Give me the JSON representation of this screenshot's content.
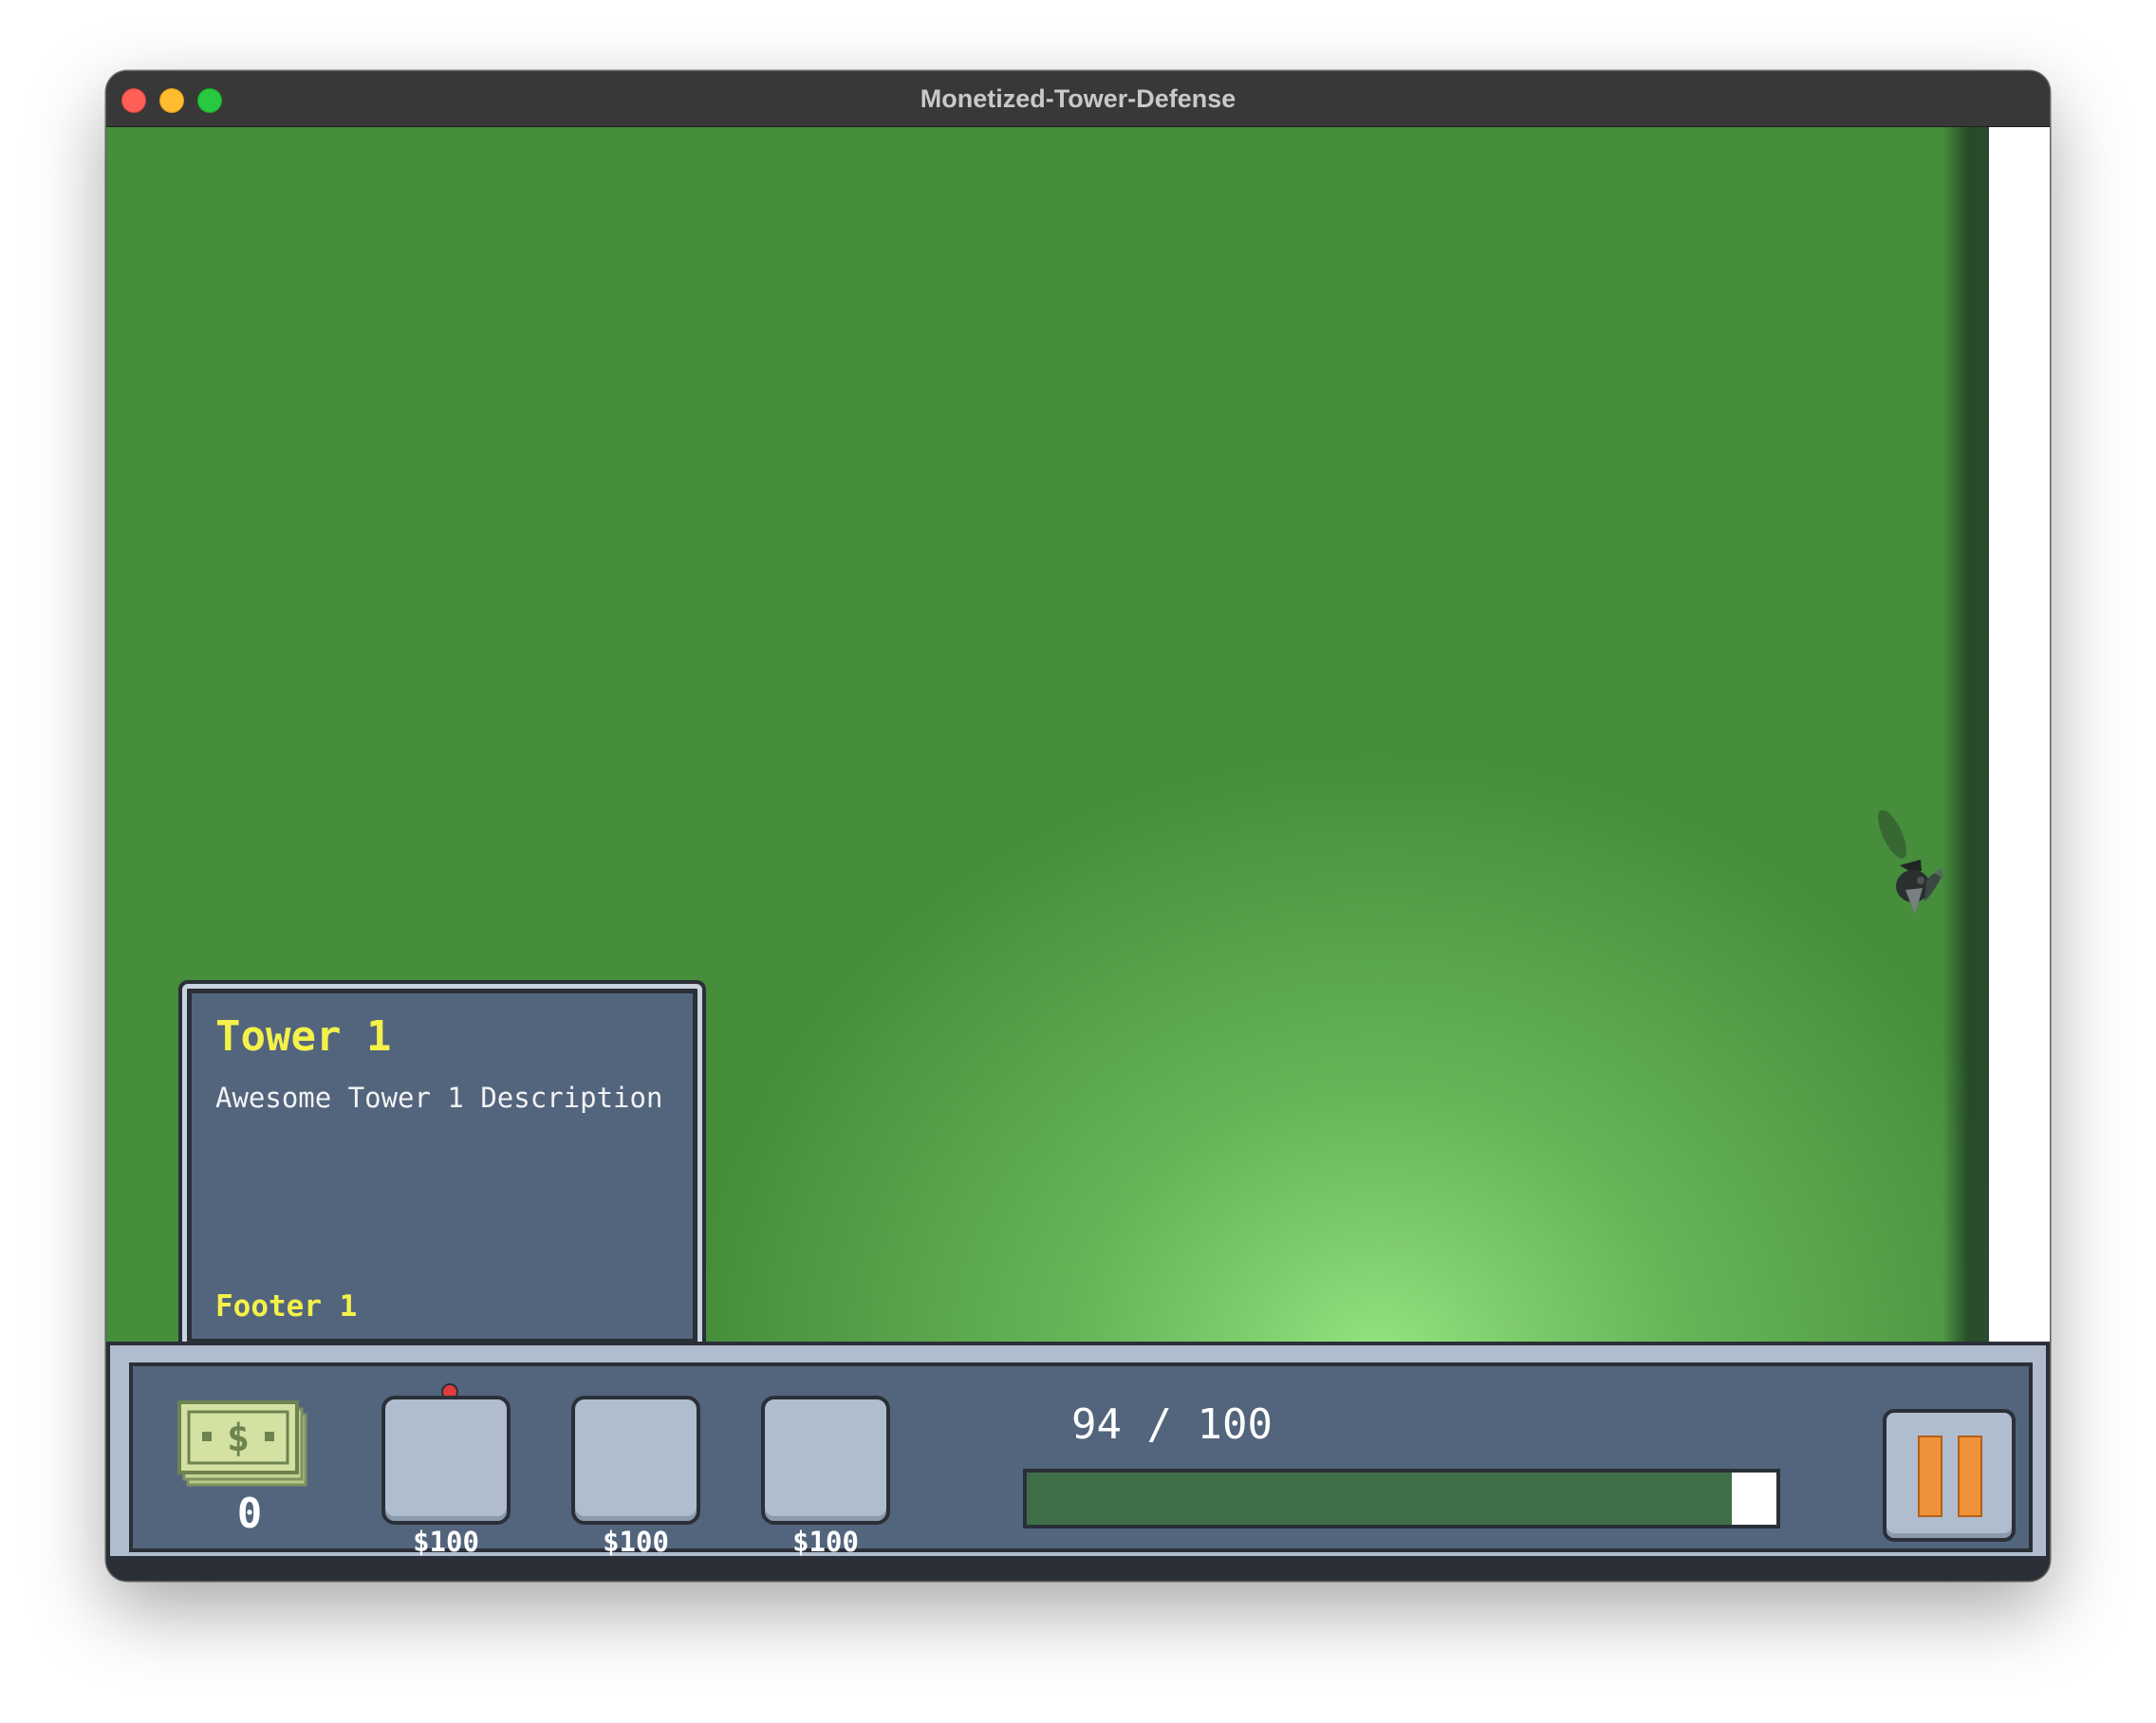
{
  "window": {
    "title": "Monetized-Tower-Defense"
  },
  "tooltip": {
    "title": "Tower 1",
    "description": "Awesome Tower 1 Description",
    "footer": "Footer 1"
  },
  "hud": {
    "cash": "0",
    "cash_icon": "dollar-bill-stack-icon",
    "slots": [
      {
        "price": "$100",
        "selected": true
      },
      {
        "price": "$100",
        "selected": false
      },
      {
        "price": "$100",
        "selected": false
      }
    ],
    "health": {
      "text": "94 / 100",
      "current": 94,
      "max": 100
    },
    "pause_icon": "pause-icon"
  },
  "colors": {
    "field_green": "#468d3c",
    "panel": "#53657d",
    "accent_yellow": "#f4f14a",
    "health_fill": "#3f6f48",
    "pause_orange": "#f0923a"
  }
}
